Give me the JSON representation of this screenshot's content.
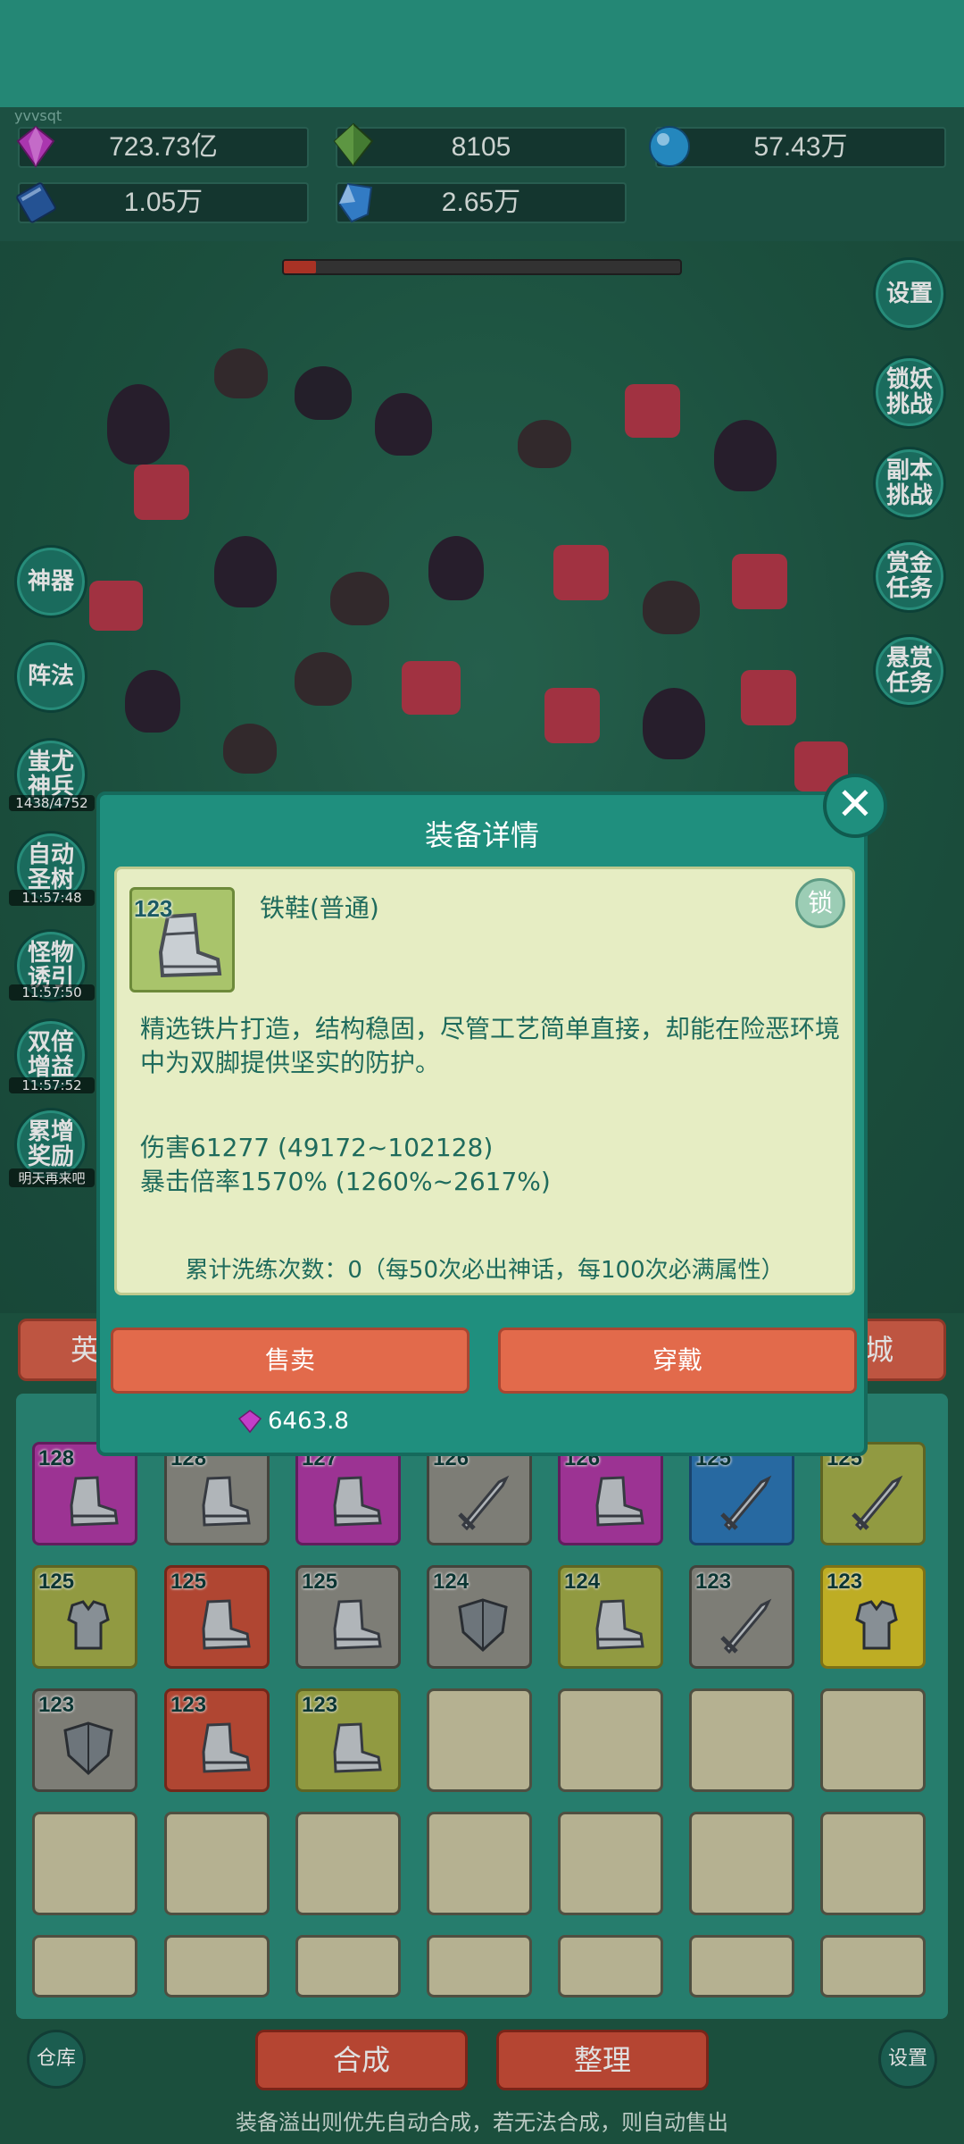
{
  "header": {
    "uid_text": "yvvsqt"
  },
  "resources": [
    {
      "icon": "purple-gem-icon",
      "value": "723.73亿",
      "color": "#c040c8"
    },
    {
      "icon": "green-crystal-icon",
      "value": "8105",
      "color": "#4e8d3a"
    },
    {
      "icon": "blue-orb-icon",
      "value": "57.43万",
      "color": "#2a9ad8"
    },
    {
      "icon": "blue-book-icon",
      "value": "1.05万",
      "color": "#2a5ea8"
    },
    {
      "icon": "blue-crystal-icon",
      "value": "2.65万",
      "color": "#3a8ce0"
    }
  ],
  "boss_hp_fraction": 0.08,
  "right_buttons": [
    {
      "id": "settings",
      "label": "设置"
    },
    {
      "id": "demon-lock",
      "label": "锁妖挑战"
    },
    {
      "id": "dungeon",
      "label": "副本挑战"
    },
    {
      "id": "bounty-gold",
      "label": "赏金任务"
    },
    {
      "id": "bounty-reward",
      "label": "悬赏任务"
    }
  ],
  "left_buttons": [
    {
      "id": "artifact",
      "label": "神器",
      "timer": ""
    },
    {
      "id": "formation",
      "label": "阵法",
      "timer": ""
    },
    {
      "id": "chiyou",
      "label": "蚩尤神兵",
      "timer": "1438/4752"
    },
    {
      "id": "auto-tree",
      "label": "自动圣树",
      "timer": "11:57:48"
    },
    {
      "id": "lure",
      "label": "怪物诱引",
      "timer": "11:57:50"
    },
    {
      "id": "double",
      "label": "双倍增益",
      "timer": "11:57:52"
    },
    {
      "id": "accum",
      "label": "累增奖励",
      "timer": "明天再来吧"
    }
  ],
  "tabs": {
    "left": "英",
    "right": "城"
  },
  "inventory": [
    {
      "lv": "128",
      "q": "purple",
      "type": "boot"
    },
    {
      "lv": "128",
      "q": "gray",
      "type": "boot"
    },
    {
      "lv": "127",
      "q": "purple",
      "type": "boot"
    },
    {
      "lv": "126",
      "q": "gray",
      "type": "sword"
    },
    {
      "lv": "126",
      "q": "purple",
      "type": "boot"
    },
    {
      "lv": "125",
      "q": "blue",
      "type": "sword"
    },
    {
      "lv": "125",
      "q": "olive",
      "type": "sword"
    },
    {
      "lv": "125",
      "q": "olive",
      "type": "armor"
    },
    {
      "lv": "125",
      "q": "red",
      "type": "boot"
    },
    {
      "lv": "125",
      "q": "gray",
      "type": "boot"
    },
    {
      "lv": "124",
      "q": "gray",
      "type": "shield"
    },
    {
      "lv": "124",
      "q": "olive",
      "type": "boot"
    },
    {
      "lv": "123",
      "q": "gray",
      "type": "sword"
    },
    {
      "lv": "123",
      "q": "yellow",
      "type": "armor"
    },
    {
      "lv": "123",
      "q": "gray",
      "type": "shield"
    },
    {
      "lv": "123",
      "q": "red",
      "type": "boot"
    },
    {
      "lv": "123",
      "q": "olive",
      "type": "boot"
    }
  ],
  "bottom": {
    "warehouse": "仓库",
    "merge": "合成",
    "organize": "整理",
    "settings": "设置",
    "note": "装备溢出则优先自动合成，若无法合成，则自动售出"
  },
  "modal": {
    "title": "装备详情",
    "close": "✕",
    "item_level": "123",
    "item_name": "铁鞋(普通)",
    "lock": "锁",
    "description": "精选铁片打造，结构稳固，尽管工艺简单直接，却能在险恶环境中为双脚提供坚实的防护。",
    "stat_damage": "伤害61277 (49172~102128)",
    "stat_crit": "暴击倍率1570% (1260%~2617%)",
    "refine_text": "累计洗练次数：0（每50次必出神话，每100次必满属性）",
    "sell": "售卖",
    "equip": "穿戴",
    "price": "6463.8"
  }
}
